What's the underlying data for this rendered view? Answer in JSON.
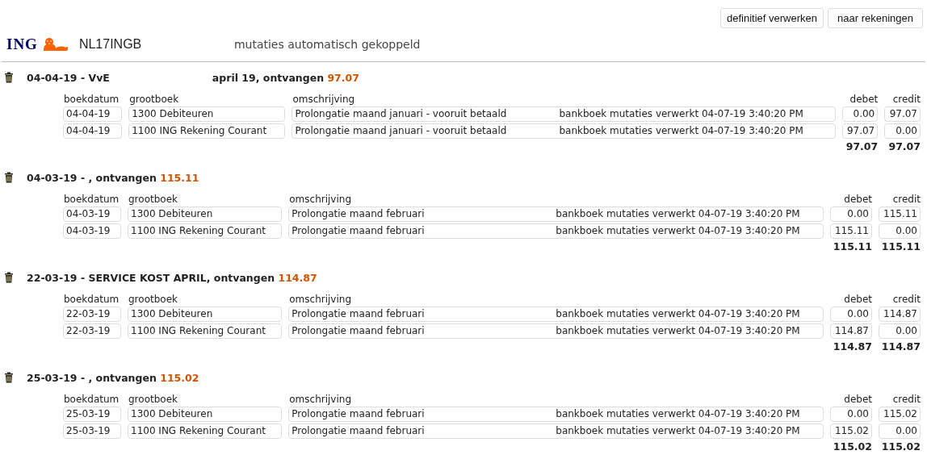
{
  "buttons": [
    "definitief verwerken",
    "naar rekeningen"
  ],
  "header": {
    "logo": "ING",
    "account": "NL17INGB",
    "status": "mutaties automatisch gekoppeld"
  },
  "groups": [
    {
      "columns": [
        "boekdatum",
        "grootboek",
        "omschrijving",
        "debet",
        "credit"
      ],
      "title": "04-04-19 - VvE",
      "subtitle": "april 19, ontvangen ",
      "amount": "97.07",
      "rows": [
        {
          "date": "04-04-19",
          "ledger": "1300 Debiteuren",
          "description": "Prolongatie maand januari - vooruit betaald",
          "note": "bankboek mutaties verwerkt 04-07-19 3:40:20 PM",
          "debet": "0.00",
          "credit": "97.07"
        },
        {
          "date": "04-04-19",
          "ledger": "1100 ING Rekening Courant",
          "description": "Prolongatie maand januari - vooruit betaald",
          "note": "bankboek mutaties verwerkt 04-07-19 3:40:20 PM",
          "debet": "97.07",
          "credit": "0.00"
        }
      ],
      "total_debet": "97.07",
      "total_credit": "97.07"
    },
    {
      "columns": [
        "boekdatum",
        "grootboek",
        "omschrijving",
        "debet",
        "credit"
      ],
      "title": "04-03-19 - , ontvangen ",
      "amount": "115.11",
      "rows": [
        {
          "date": "04-03-19",
          "ledger": "1300 Debiteuren",
          "description": "Prolongatie maand februari",
          "note": "bankboek mutaties verwerkt 04-07-19 3:40:20 PM",
          "debet": "0.00",
          "credit": "115.11"
        },
        {
          "date": "04-03-19",
          "ledger": "1100 ING Rekening Courant",
          "description": "Prolongatie maand februari",
          "note": "bankboek mutaties verwerkt 04-07-19 3:40:20 PM",
          "debet": "115.11",
          "credit": "0.00"
        }
      ],
      "total_debet": "115.11",
      "total_credit": "115.11"
    },
    {
      "columns": [
        "boekdatum",
        "grootboek",
        "omschrijving",
        "debet",
        "credit"
      ],
      "title": "22-03-19 - SERVICE KOST APRIL, ontvangen ",
      "amount": "114.87",
      "rows": [
        {
          "date": "22-03-19",
          "ledger": "1300 Debiteuren",
          "description": "Prolongatie maand februari",
          "note": "bankboek mutaties verwerkt 04-07-19 3:40:20 PM",
          "debet": "0.00",
          "credit": "114.87"
        },
        {
          "date": "22-03-19",
          "ledger": "1100 ING Rekening Courant",
          "description": "Prolongatie maand februari",
          "note": "bankboek mutaties verwerkt 04-07-19 3:40:20 PM",
          "debet": "114.87",
          "credit": "0.00"
        }
      ],
      "total_debet": "114.87",
      "total_credit": "114.87"
    },
    {
      "columns": [
        "boekdatum",
        "grootboek",
        "omschrijving",
        "debet",
        "credit"
      ],
      "title": "25-03-19 - , ontvangen ",
      "amount": "115.02",
      "rows": [
        {
          "date": "25-03-19",
          "ledger": "1300 Debiteuren",
          "description": "Prolongatie maand februari",
          "note": "bankboek mutaties verwerkt 04-07-19 3:40:20 PM",
          "debet": "0.00",
          "credit": "115.02"
        },
        {
          "date": "25-03-19",
          "ledger": "1100 ING Rekening Courant",
          "description": "Prolongatie maand februari",
          "note": "bankboek mutaties verwerkt 04-07-19 3:40:20 PM",
          "debet": "115.02",
          "credit": "0.00"
        }
      ],
      "total_debet": "115.02",
      "total_credit": "115.02"
    }
  ]
}
